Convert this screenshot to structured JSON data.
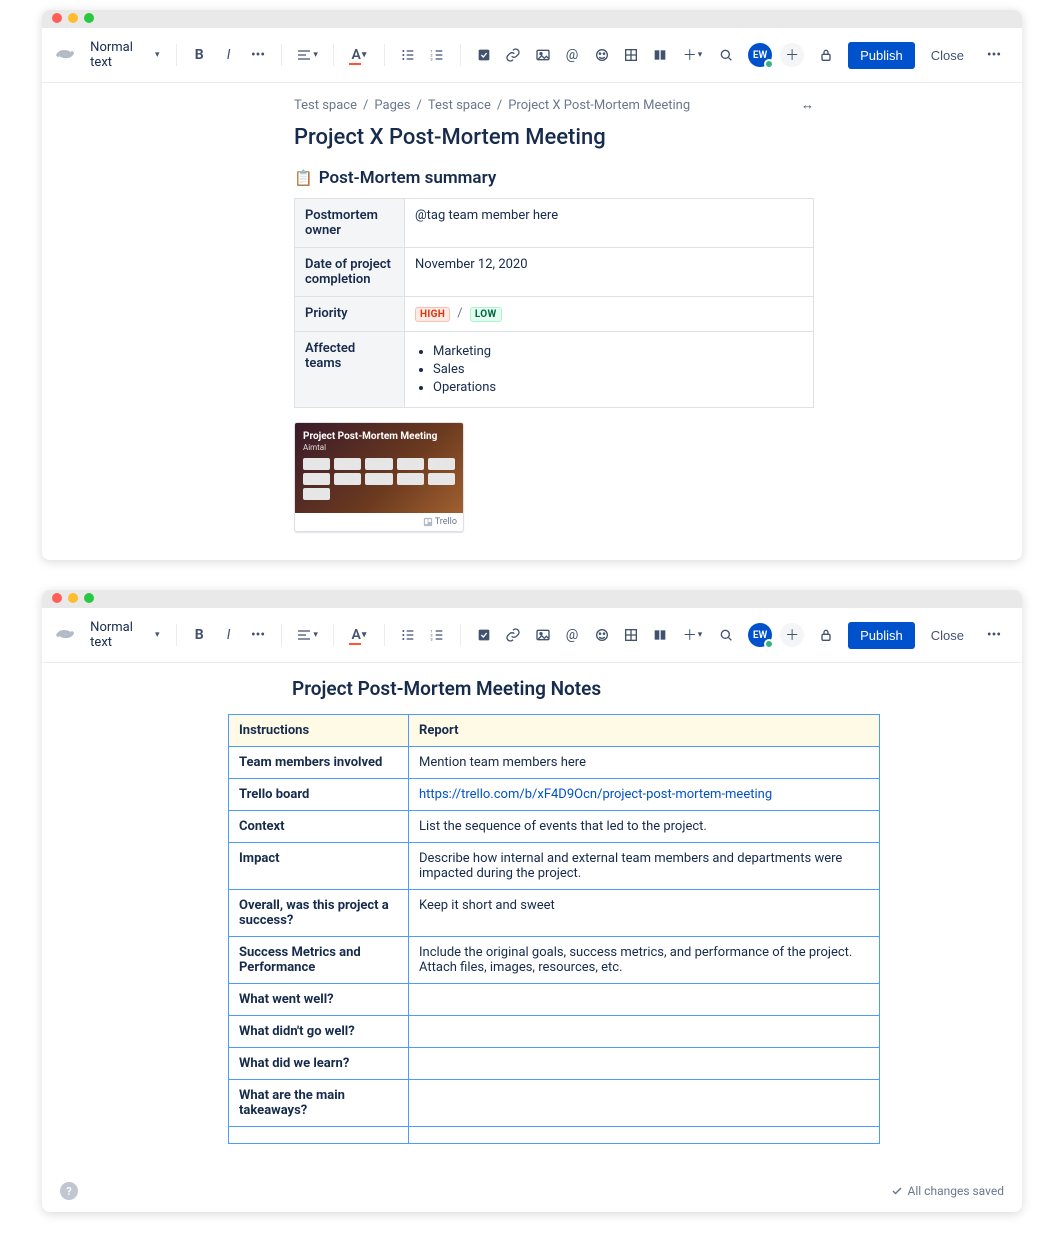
{
  "toolbar": {
    "text_style": "Normal text",
    "publish": "Publish",
    "close": "Close",
    "avatar_initials": "EW"
  },
  "breadcrumb": {
    "space": "Test space",
    "section": "Pages",
    "space2": "Test space",
    "current": "Project X Post-Mortem Meeting"
  },
  "page1": {
    "title": "Project X Post-Mortem Meeting",
    "section_title": "Post-Mortem summary",
    "rows": {
      "owner_label": "Postmortem owner",
      "owner_value": "@tag team member here",
      "date_label": "Date of project completion",
      "date_value": "November 12, 2020",
      "priority_label": "Priority",
      "priority_high": "HIGH",
      "priority_sep": "/",
      "priority_low": "LOW",
      "teams_label": "Affected teams",
      "teams": [
        "Marketing",
        "Sales",
        "Operations"
      ]
    },
    "card": {
      "title": "Project Post-Mortem Meeting",
      "subtitle": "Aimtal",
      "footer": "Trello"
    }
  },
  "page2": {
    "title": "Project Post-Mortem Meeting Notes",
    "headers": {
      "col1": "Instructions",
      "col2": "Report"
    },
    "rows": [
      {
        "label": "Team members involved",
        "value": "Mention team members here"
      },
      {
        "label": "Trello board",
        "link": "https://trello.com/b/xF4D9Ocn/project-post-mortem-meeting"
      },
      {
        "label": "Context",
        "value": "List the sequence of events that led to the project."
      },
      {
        "label": "Impact",
        "value": "Describe how internal and external team members and departments were impacted during the project."
      },
      {
        "label": "Overall, was this project a success?",
        "value": "Keep it short and sweet"
      },
      {
        "label": "Success Metrics and Performance",
        "value": "Include the original goals, success metrics, and performance of the project. Attach files, images, resources, etc."
      },
      {
        "label": "What went well?",
        "value": ""
      },
      {
        "label": "What didn't go well?",
        "value": ""
      },
      {
        "label": "What did we learn?",
        "value": ""
      },
      {
        "label": "What are the main takeaways?",
        "value": ""
      },
      {
        "label": "",
        "value": ""
      }
    ]
  },
  "footer": {
    "saved": "All changes saved"
  }
}
